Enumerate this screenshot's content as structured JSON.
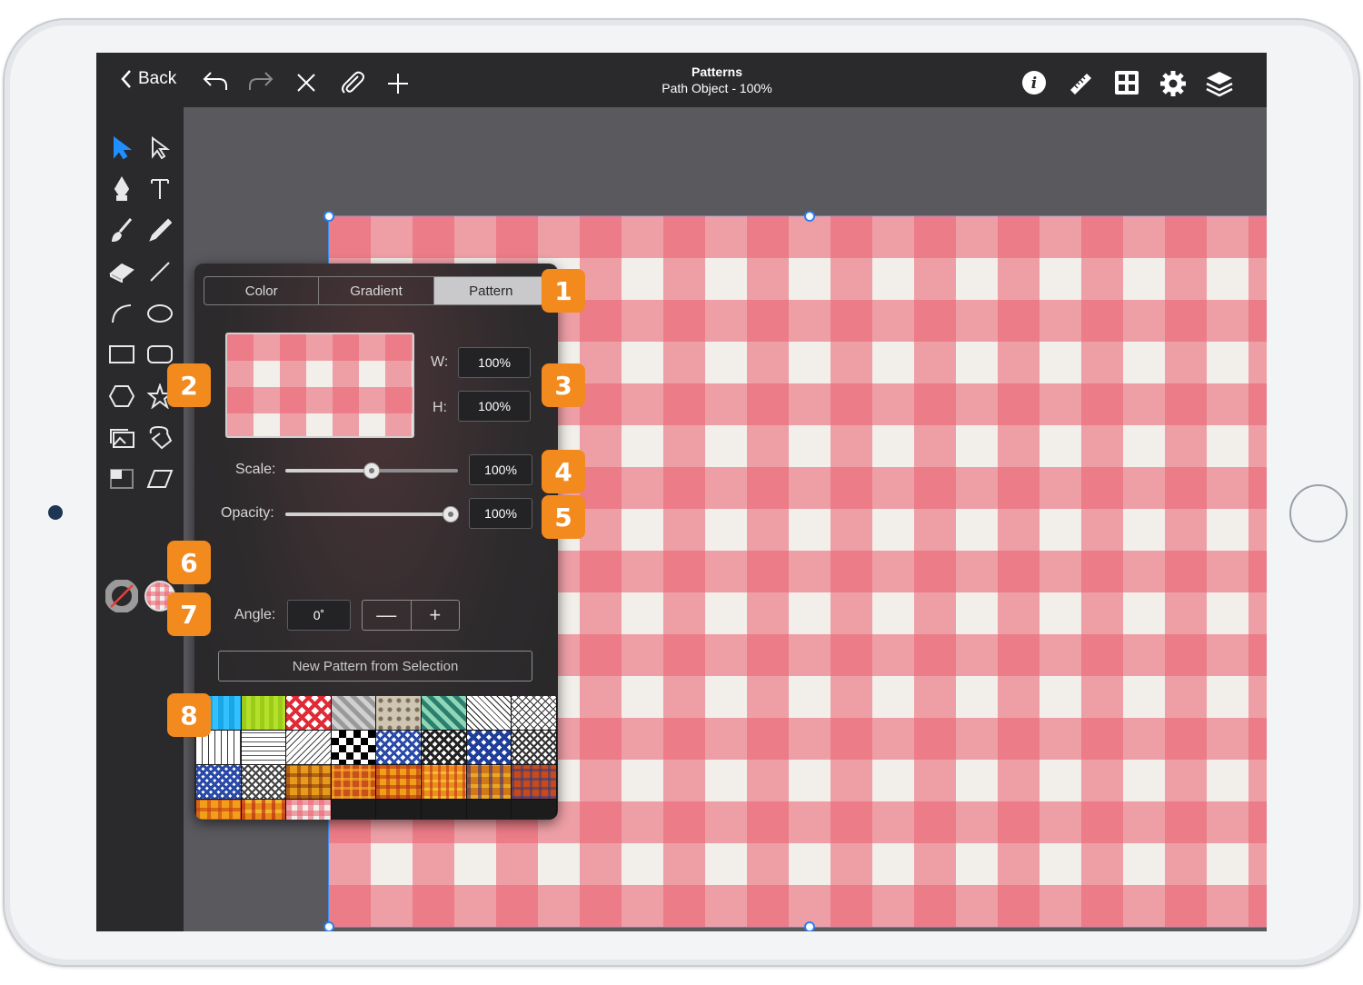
{
  "toolbar": {
    "back_label": "Back",
    "title": "Patterns",
    "subtitle": "Path Object - 100%",
    "left_icons": [
      "undo-icon",
      "redo-icon",
      "close-icon",
      "paperclip-icon",
      "plus-icon"
    ],
    "right_icons": [
      "info-icon",
      "ruler-icon",
      "grid-icon",
      "gear-icon",
      "layers-icon"
    ]
  },
  "tools": [
    "select-arrow-icon",
    "direct-select-icon",
    "pen-icon",
    "text-icon",
    "brush-icon",
    "pencil-icon",
    "eraser-icon",
    "line-icon",
    "arc-icon",
    "ellipse-icon",
    "rectangle-icon",
    "rounded-rectangle-icon",
    "hexagon-icon",
    "star-icon",
    "image-icon",
    "lasso-icon",
    "frame-icon",
    "parallelogram-icon"
  ],
  "fill_panel": {
    "tabs": [
      "Color",
      "Gradient",
      "Pattern"
    ],
    "active_tab": "Pattern",
    "w_label": "W:",
    "w_value": "100%",
    "h_label": "H:",
    "h_value": "100%",
    "scale_label": "Scale:",
    "scale_value": "100%",
    "scale_slider": 0.5,
    "opacity_label": "Opacity:",
    "opacity_value": "100%",
    "opacity_slider": 1.0,
    "angle_label": "Angle:",
    "angle_value": "0˚",
    "stepper_minus": "—",
    "stepper_plus": "+",
    "new_pattern_label": "New Pattern from Selection"
  },
  "callouts": [
    "1",
    "2",
    "3",
    "4",
    "5",
    "6",
    "7",
    "8"
  ],
  "colors": {
    "accent_blue": "#2a7ff0",
    "callout_orange": "#f28a1e",
    "gingham_red": "#eb5f6e",
    "gingham_cream": "#f2eeea"
  }
}
